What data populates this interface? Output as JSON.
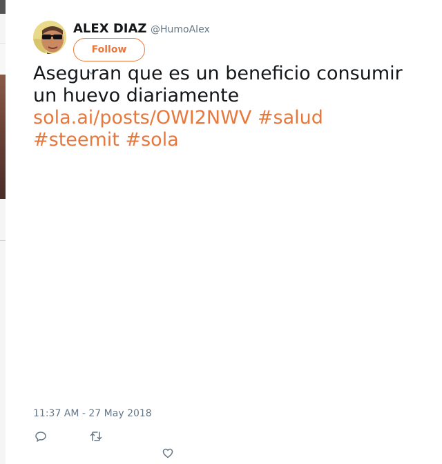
{
  "tweet": {
    "author": {
      "name": "ALEX DIAZ",
      "handle": "@HumoAlex"
    },
    "follow_label": "Follow",
    "text_line1": "Aseguran que es un beneficio consumir",
    "text_line2": "un huevo diariamente",
    "link": "sola.ai/posts/OWI2NWV",
    "hashtags": [
      "#salud",
      "#steemit",
      "#sola"
    ],
    "timestamp": "11:37 AM - 27 May 2018"
  },
  "colors": {
    "accent": "#e8773b",
    "text": "#14171a",
    "muted": "#657786"
  },
  "icons": {
    "reply": "speech-bubble-icon",
    "retweet": "retweet-arrows-icon",
    "like": "heart-icon",
    "more": "chevron-down-icon"
  }
}
